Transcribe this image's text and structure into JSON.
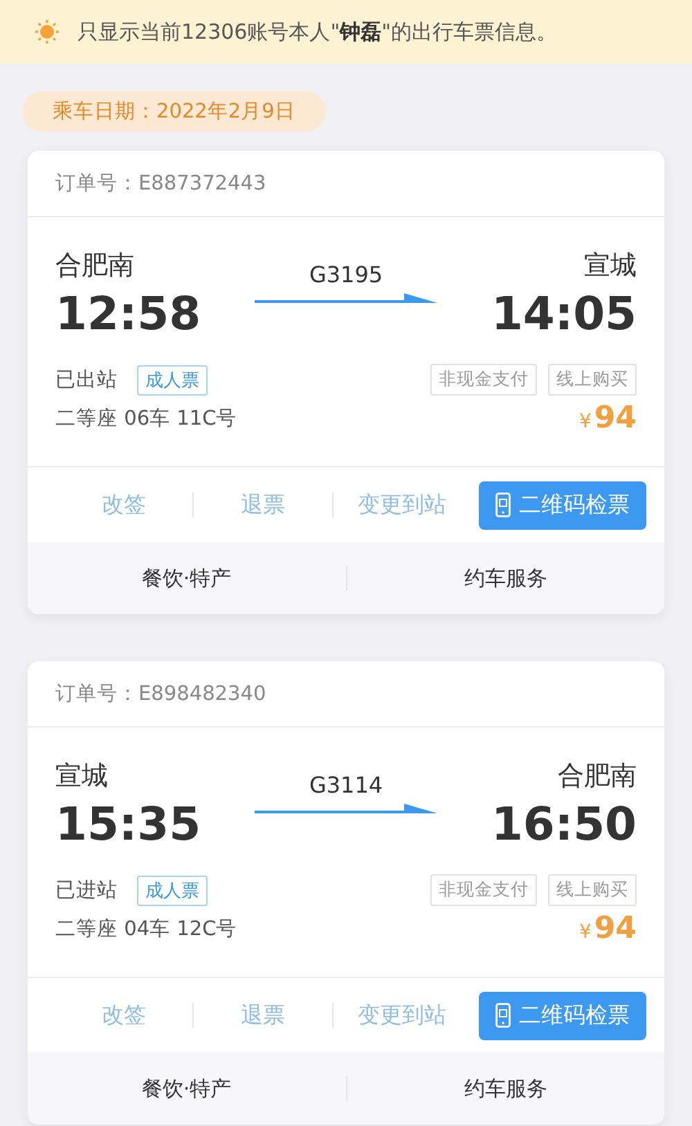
{
  "notice": {
    "text": "只显示当前12306账号本人\"**钟磊**\"的出行车票信息。"
  },
  "date_label": "乘车日期：2022年2月9日",
  "tickets": [
    {
      "order": "订单号：E887372443",
      "from": "合肥南",
      "to": "宣城",
      "train": "G3195",
      "depart": "12:58",
      "arrive": "14:05",
      "status": "已出站",
      "ticket_type": "成人票",
      "tags": [
        "非现金支付",
        "线上购买"
      ],
      "seat": "二等座 06车 11C号",
      "price_symbol": "¥",
      "price": "94",
      "actions": [
        {
          "label": "改签",
          "kind": "text",
          "disabled": true
        },
        {
          "label": "退票",
          "kind": "text",
          "disabled": true
        },
        {
          "label": "变更到站",
          "kind": "text",
          "disabled": true
        },
        {
          "label": "二维码检票",
          "kind": "primary",
          "disabled": false
        }
      ],
      "services": [
        "餐饮·特产",
        "约车服务"
      ]
    },
    {
      "order": "订单号：E898482340",
      "from": "宣城",
      "to": "合肥南",
      "train": "G3114",
      "depart": "15:35",
      "arrive": "16:50",
      "status": "已进站",
      "ticket_type": "成人票",
      "tags": [
        "非现金支付",
        "线上购买"
      ],
      "seat": "二等座 04车 12C号",
      "price_symbol": "¥",
      "price": "94",
      "actions": [
        {
          "label": "改签",
          "kind": "text",
          "disabled": true
        },
        {
          "label": "退票",
          "kind": "text",
          "disabled": true
        },
        {
          "label": "变更到站",
          "kind": "text",
          "disabled": true
        },
        {
          "label": "二维码检票",
          "kind": "primary",
          "disabled": false
        }
      ],
      "services": [
        "餐饮·特产",
        "约车服务"
      ]
    }
  ]
}
